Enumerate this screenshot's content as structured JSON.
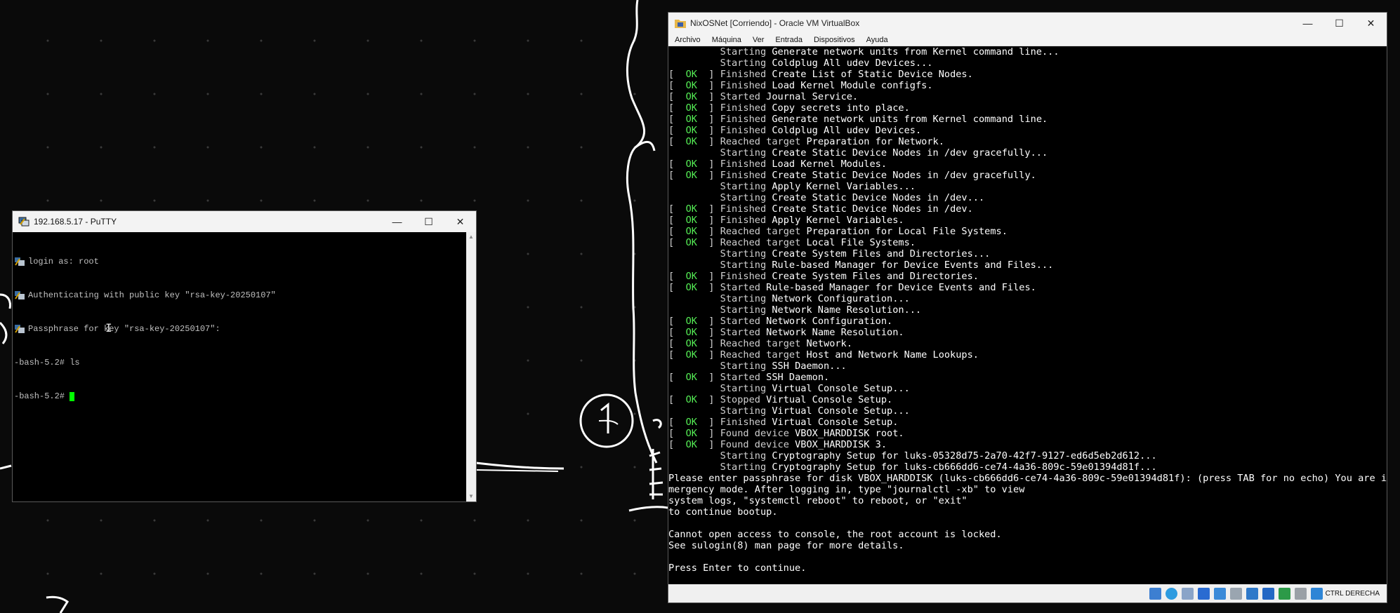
{
  "putty": {
    "title": "192.168.5.17 - PuTTY",
    "minimize": "—",
    "maximize": "☐",
    "close": "✕",
    "lines": [
      "login as: root",
      "Authenticating with public key \"rsa-key-20250107\"",
      "Passphrase for key \"rsa-key-20250107\":",
      "-bash-5.2# ls",
      "-bash-5.2# "
    ]
  },
  "vbox": {
    "title": "NixOSNet [Corriendo] - Oracle VM VirtualBox",
    "minimize": "—",
    "maximize": "☐",
    "close": "✕",
    "menu": [
      "Archivo",
      "Máquina",
      "Ver",
      "Entrada",
      "Dispositivos",
      "Ayuda"
    ],
    "status_text": "CTRL DERECHA",
    "console": [
      [
        "",
        "         Starting ",
        "Generate network units from Kernel command line..."
      ],
      [
        "",
        "         Starting ",
        "Coldplug All udev Devices..."
      ],
      [
        "OK",
        "Finished ",
        "Create List of Static Device Nodes."
      ],
      [
        "OK",
        "Finished ",
        "Load Kernel Module configfs."
      ],
      [
        "OK",
        "Started ",
        "Journal Service."
      ],
      [
        "OK",
        "Finished ",
        "Copy secrets into place."
      ],
      [
        "OK",
        "Finished ",
        "Generate network units from Kernel command line."
      ],
      [
        "OK",
        "Finished ",
        "Coldplug All udev Devices."
      ],
      [
        "OK",
        "Reached target ",
        "Preparation for Network."
      ],
      [
        "",
        "         Starting ",
        "Create Static Device Nodes in /dev gracefully..."
      ],
      [
        "OK",
        "Finished ",
        "Load Kernel Modules."
      ],
      [
        "OK",
        "Finished ",
        "Create Static Device Nodes in /dev gracefully."
      ],
      [
        "",
        "         Starting ",
        "Apply Kernel Variables..."
      ],
      [
        "",
        "         Starting ",
        "Create Static Device Nodes in /dev..."
      ],
      [
        "OK",
        "Finished ",
        "Create Static Device Nodes in /dev."
      ],
      [
        "OK",
        "Finished ",
        "Apply Kernel Variables."
      ],
      [
        "OK",
        "Reached target ",
        "Preparation for Local File Systems."
      ],
      [
        "OK",
        "Reached target ",
        "Local File Systems."
      ],
      [
        "",
        "         Starting ",
        "Create System Files and Directories..."
      ],
      [
        "",
        "         Starting ",
        "Rule-based Manager for Device Events and Files..."
      ],
      [
        "OK",
        "Finished ",
        "Create System Files and Directories."
      ],
      [
        "OK",
        "Started ",
        "Rule-based Manager for Device Events and Files."
      ],
      [
        "",
        "         Starting ",
        "Network Configuration..."
      ],
      [
        "",
        "         Starting ",
        "Network Name Resolution..."
      ],
      [
        "OK",
        "Started ",
        "Network Configuration."
      ],
      [
        "OK",
        "Started ",
        "Network Name Resolution."
      ],
      [
        "OK",
        "Reached target ",
        "Network."
      ],
      [
        "OK",
        "Reached target ",
        "Host and Network Name Lookups."
      ],
      [
        "",
        "         Starting ",
        "SSH Daemon..."
      ],
      [
        "OK",
        "Started ",
        "SSH Daemon."
      ],
      [
        "",
        "         Starting ",
        "Virtual Console Setup..."
      ],
      [
        "OK",
        "Stopped ",
        "Virtual Console Setup."
      ],
      [
        "",
        "         Starting ",
        "Virtual Console Setup..."
      ],
      [
        "OK",
        "Finished ",
        "Virtual Console Setup."
      ],
      [
        "OK",
        "Found device ",
        "VBOX_HARDDISK root."
      ],
      [
        "OK",
        "Found device ",
        "VBOX_HARDDISK 3."
      ],
      [
        "",
        "         Starting ",
        "Cryptography Setup for luks-05328d75-2a70-42f7-9127-ed6d5eb2d612..."
      ],
      [
        "",
        "         Starting ",
        "Cryptography Setup for luks-cb666dd6-ce74-4a36-809c-59e01394d81f..."
      ]
    ],
    "plain": [
      "Please enter passphrase for disk VBOX_HARDDISK (luks-cb666dd6-ce74-4a36-809c-59e01394d81f): (press TAB for no echo) You are in e",
      "mergency mode. After logging in, type \"journalctl -xb\" to view",
      "system logs, \"systemctl reboot\" to reboot, or \"exit\"",
      "to continue bootup.",
      "",
      "Cannot open access to console, the root account is locked.",
      "See sulogin(8) man page for more details.",
      "",
      "Press Enter to continue."
    ]
  },
  "colors": {
    "ok": "#55ee55",
    "cursor": "#00ff00",
    "scribble": "#ffffff"
  }
}
